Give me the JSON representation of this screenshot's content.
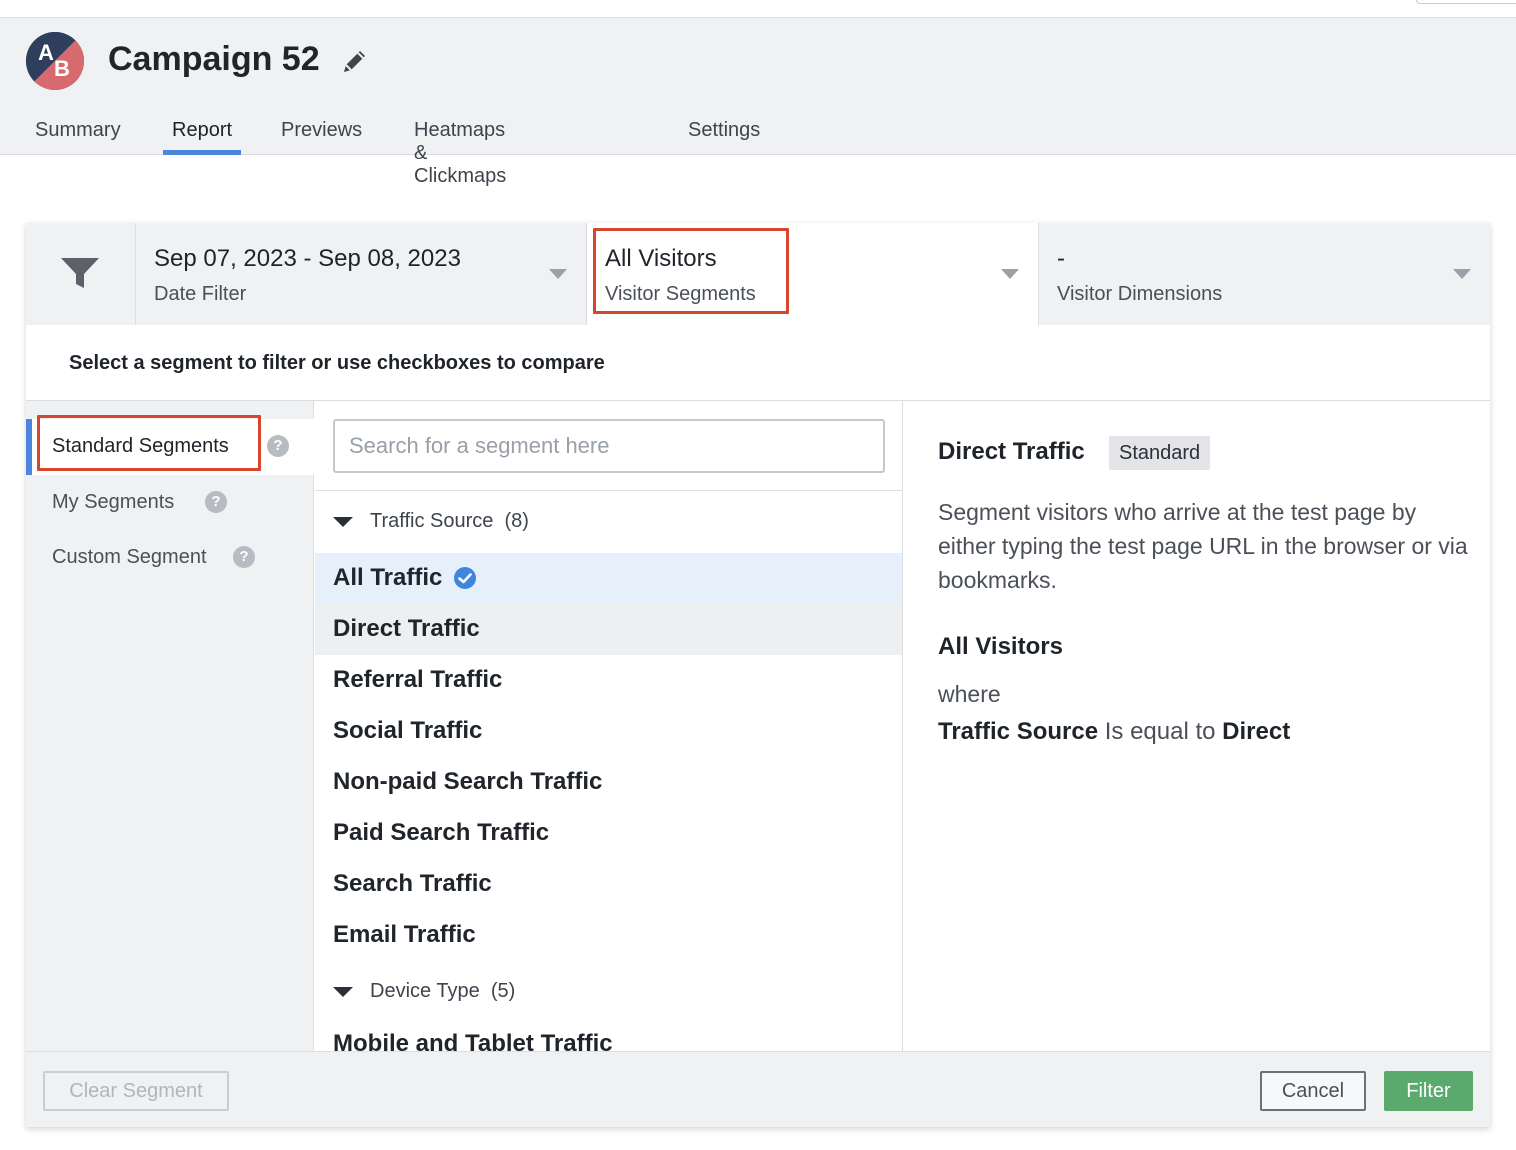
{
  "header": {
    "logo_a": "A",
    "logo_b": "B",
    "title": "Campaign 52",
    "tabs": [
      {
        "label": "Summary"
      },
      {
        "label": "Report"
      },
      {
        "label": "Previews"
      },
      {
        "label": "Heatmaps & Clickmaps"
      },
      {
        "label": "Settings"
      }
    ],
    "active_tab": "Report"
  },
  "filters": {
    "date": {
      "value": "Sep 07, 2023 - Sep 08, 2023",
      "label": "Date Filter"
    },
    "segments": {
      "value": "All Visitors",
      "label": "Visitor Segments"
    },
    "dimensions": {
      "value": "-",
      "label": "Visitor Dimensions"
    }
  },
  "instruction": "Select a segment to filter or use checkboxes to compare",
  "left_nav": [
    {
      "label": "Standard Segments",
      "help": "?"
    },
    {
      "label": "My Segments",
      "help": "?"
    },
    {
      "label": "Custom Segment",
      "help": "?"
    }
  ],
  "search": {
    "placeholder": "Search for a segment here"
  },
  "groups": [
    {
      "name": "Traffic Source",
      "count": "(8)",
      "items": [
        "All Traffic",
        "Direct Traffic",
        "Referral Traffic",
        "Social Traffic",
        "Non-paid Search Traffic",
        "Paid Search Traffic",
        "Search Traffic",
        "Email Traffic"
      ]
    },
    {
      "name": "Device Type",
      "count": "(5)",
      "items": [
        "Mobile and Tablet Traffic"
      ]
    }
  ],
  "detail": {
    "title": "Direct Traffic",
    "badge": "Standard",
    "description": "Segment visitors who arrive at the test page by either typing the test page URL in the browser or via bookmarks.",
    "rule_title": "All Visitors",
    "where": "where",
    "rule_field": "Traffic Source",
    "rule_op": "Is equal to",
    "rule_value": "Direct"
  },
  "footer": {
    "clear_label": "Clear Segment",
    "cancel_label": "Cancel",
    "filter_label": "Filter"
  },
  "colors": {
    "accent": "#4a86dd",
    "highlight_box": "#d9442c",
    "filter_button": "#5aaa6d",
    "selected_row": "#e6f0fa"
  }
}
